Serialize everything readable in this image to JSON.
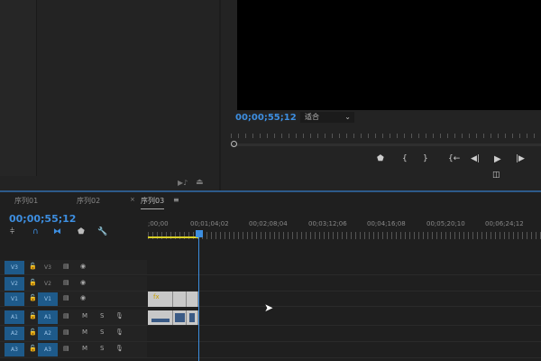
{
  "source_panel": {
    "icons": [
      "insert-icon",
      "export-icon"
    ]
  },
  "program": {
    "timecode": "00;00;55;12",
    "fit_select": "适合",
    "chevron": "⌄",
    "controls": [
      {
        "name": "add-marker",
        "glyph": "⬟"
      },
      {
        "name": "mark-in",
        "glyph": "{"
      },
      {
        "name": "mark-out",
        "glyph": "}"
      },
      {
        "name": "go-to-in",
        "glyph": "{←"
      },
      {
        "name": "step-back",
        "glyph": "◀|"
      },
      {
        "name": "play",
        "glyph": "▶"
      },
      {
        "name": "step-forward",
        "glyph": "|▶"
      }
    ],
    "compare_glyph": "◫"
  },
  "timeline": {
    "tabs": [
      {
        "label": "序列01"
      },
      {
        "label": "序列02"
      },
      {
        "label": "序列03"
      }
    ],
    "close": "×",
    "menu": "≡",
    "timecode": "00;00;55;12",
    "ruler": [
      ";00;00",
      "00;01;04;02",
      "00;02;08;04",
      "00;03;12;06",
      "00;04;16;08",
      "00;05;20;10",
      "00;06;24;12"
    ],
    "video_tracks": [
      {
        "target": "V3",
        "source": "V3",
        "source_on": false
      },
      {
        "target": "V2",
        "source": "V2",
        "source_on": false
      },
      {
        "target": "V1",
        "source": "V1",
        "source_on": true
      }
    ],
    "audio_tracks": [
      {
        "target": "A1",
        "source": "A1",
        "m": "M",
        "s": "S"
      },
      {
        "target": "A2",
        "source": "A2",
        "m": "M",
        "s": "S"
      },
      {
        "target": "A3",
        "source": "A3",
        "m": "M",
        "s": "S"
      }
    ],
    "fx_badge": "fx"
  },
  "colors": {
    "accent": "#3d8ee0",
    "target": "#1e5a8a",
    "work_area": "#d9d026"
  }
}
